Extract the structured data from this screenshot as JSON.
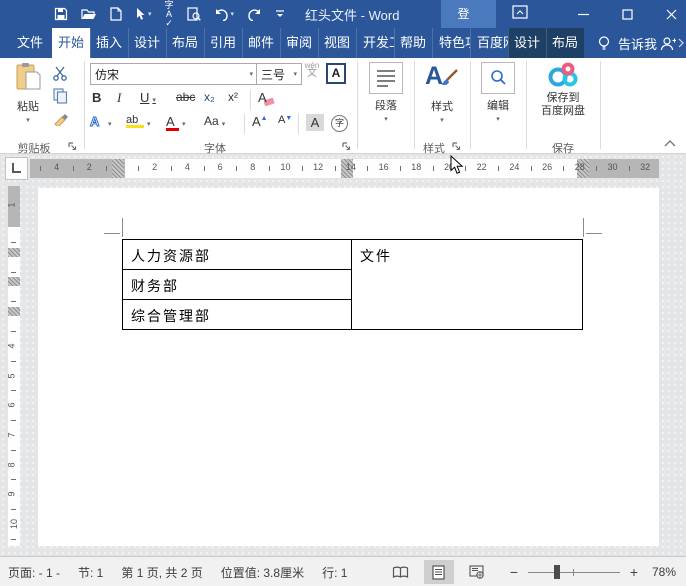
{
  "colors": {
    "titlebar_blue": "#2b579a",
    "contextual_tab": "#1e4065",
    "login_bg": "#4a79bd",
    "highlight_yellow": "#f7e11b",
    "font_color_red": "#e00000",
    "accent_blue": "#2b6cd4",
    "baidu_red": "#f15a7f",
    "baidu_blue": "#2ea7e0",
    "baidu_cyan": "#27c5e5"
  },
  "titlebar": {
    "title": "红头文件 - Word",
    "login_label": "登录"
  },
  "tabs": [
    {
      "label": "文件"
    },
    {
      "label": "开始"
    },
    {
      "label": "插入"
    },
    {
      "label": "设计"
    },
    {
      "label": "布局"
    },
    {
      "label": "引用"
    },
    {
      "label": "邮件"
    },
    {
      "label": "审阅"
    },
    {
      "label": "视图"
    },
    {
      "label": "开发工具"
    },
    {
      "label": "帮助"
    },
    {
      "label": "特色功能"
    },
    {
      "label": "百度网盘"
    },
    {
      "label": "设计"
    },
    {
      "label": "布局"
    }
  ],
  "tellme_label": "告诉我",
  "ribbon": {
    "clipboard": {
      "paste_label": "粘贴",
      "group_label": "剪贴板"
    },
    "font": {
      "name_value": "仿宋",
      "size_value": "三号",
      "group_label": "字体",
      "phonetic_top": "wén",
      "phonetic_bottom": "文",
      "char_border": "A",
      "bold": "B",
      "italic": "I",
      "underline": "U",
      "strikethrough": "abc",
      "subscript": "x₂",
      "superscript": "x²",
      "clear_format": "A",
      "text_effects": "A",
      "highlight": "ab",
      "font_color": "A",
      "change_case": "Aa",
      "grow_font": "A",
      "shrink_font": "A",
      "char_shading": "A",
      "enclose_char": "字"
    },
    "paragraph": {
      "label": "段落"
    },
    "styles": {
      "label": "样式",
      "group_label": "样式"
    },
    "editing": {
      "label": "编辑"
    },
    "baidu": {
      "line1": "保存到",
      "line2": "百度网盘",
      "group_label": "保存"
    }
  },
  "ruler": {
    "h_left_numbers": [
      "2",
      "4"
    ],
    "h_main_numbers": [
      "2",
      "4",
      "6",
      "8",
      "10",
      "12",
      "14",
      "16",
      "18",
      "20",
      "22",
      "24",
      "26",
      "28",
      "30",
      "32"
    ],
    "v_top_number": "1",
    "v_numbers": [
      "4",
      "5",
      "6",
      "7",
      "8",
      "9",
      "10"
    ]
  },
  "document": {
    "table": {
      "rows": [
        "人力资源部",
        "财务部",
        "综合管理部"
      ],
      "merged_cell": "文件"
    }
  },
  "statusbar": {
    "page": "页面: - 1 -",
    "section": "节: 1",
    "pages": "第 1 页, 共 2 页",
    "position": "位置值: 3.8厘米",
    "line": "行: 1",
    "zoom_minus": "−",
    "zoom_plus": "+",
    "zoom_value": "78%"
  }
}
